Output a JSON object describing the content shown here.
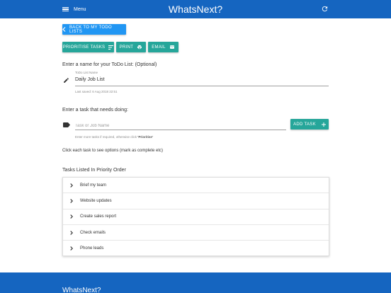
{
  "header": {
    "menu_label": "Menu",
    "title": "WhatsNext?",
    "icons": {
      "menu": "hamburger-icon",
      "refresh": "refresh-icon"
    }
  },
  "toolbar": {
    "back_label": "BACK TO MY TODO LISTS",
    "prioritise_label": "PRIORITISE TASKS",
    "print_label": "PRINT",
    "email_label": "EMAIL"
  },
  "list_name": {
    "heading": "Enter a name for your ToDo List: (Optional)",
    "field_label": "ToDo List Name",
    "value": "Daily Job List",
    "last_saved": "Last saved: 6 Aug 2018 22:51"
  },
  "new_task": {
    "heading": "Enter a task that needs doing:",
    "placeholder": "Task or Job Name",
    "add_label": "ADD TASK",
    "help_prefix": "Enter more tasks if required, otherwise click ",
    "help_bold": "'Prioritise'"
  },
  "instructions": "Click each task to see options (mark as complete etc)",
  "tasks": {
    "heading": "Tasks Listed In Priority Order",
    "items": [
      {
        "label": "Brief my team"
      },
      {
        "label": "Website updates"
      },
      {
        "label": "Create sales report"
      },
      {
        "label": "Check emails"
      },
      {
        "label": "Phone leads"
      }
    ]
  },
  "footer": {
    "title": "WhatsNext?"
  },
  "colors": {
    "header_bg": "#1565c0",
    "primary_button": "#2196f3",
    "teal_button": "#26a69a"
  }
}
